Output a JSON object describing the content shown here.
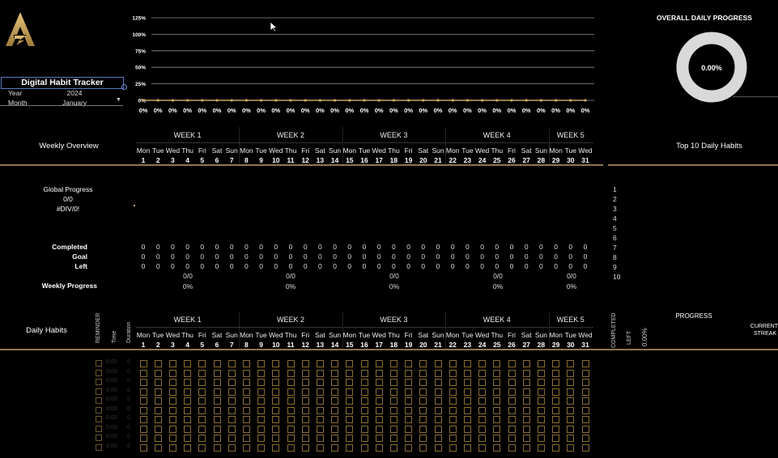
{
  "sidebar": {
    "title": "Digital Habit Tracker",
    "year_label": "Year",
    "year_value": "2024",
    "month_label": "Month",
    "month_value": "January"
  },
  "chart_data": {
    "type": "line",
    "y_ticks": [
      "125%",
      "100%",
      "75%",
      "50%",
      "25%",
      "0%"
    ],
    "ylim": [
      0,
      1.25
    ],
    "x": [
      1,
      2,
      3,
      4,
      5,
      6,
      7,
      8,
      9,
      10,
      11,
      12,
      13,
      14,
      15,
      16,
      17,
      18,
      19,
      20,
      21,
      22,
      23,
      24,
      25,
      26,
      27,
      28,
      29,
      30,
      31
    ],
    "values": [
      0,
      0,
      0,
      0,
      0,
      0,
      0,
      0,
      0,
      0,
      0,
      0,
      0,
      0,
      0,
      0,
      0,
      0,
      0,
      0,
      0,
      0,
      0,
      0,
      0,
      0,
      0,
      0,
      0,
      0,
      0
    ],
    "value_labels": [
      "0%",
      "0%",
      "0%",
      "0%",
      "0%",
      "0%",
      "0%",
      "0%",
      "0%",
      "0%",
      "0%",
      "0%",
      "0%",
      "0%",
      "0%",
      "0%",
      "0%",
      "0%",
      "0%",
      "0%",
      "0%",
      "0%",
      "0%",
      "0%",
      "0%",
      "0%",
      "0%",
      "0%",
      "0%",
      "0%",
      "0%"
    ],
    "line_color": "#c9a463",
    "grid": true
  },
  "overall": {
    "title": "OVERALL DAILY PROGRESS",
    "value": "0.00%",
    "ring_color": "#d9d9d9"
  },
  "weekly_overview": {
    "title": "Weekly Overview",
    "top_habits_title": "Top 10 Daily Habits",
    "global_progress_label": "Global Progress",
    "global_progress_count": "0/0",
    "global_progress_pct": "#DIV/0!",
    "rows": [
      "Completed",
      "Goal",
      "Left"
    ],
    "weekly_progress_label": "Weekly Progress",
    "week_summaries": [
      {
        "count": "0/0",
        "pct": "0%"
      },
      {
        "count": "0/0",
        "pct": "0%"
      },
      {
        "count": "0/0",
        "pct": "0%"
      },
      {
        "count": "0/0",
        "pct": "0%"
      },
      {
        "count": "0/0",
        "pct": "0%"
      }
    ],
    "ranks": [
      "1",
      "2",
      "3",
      "4",
      "5",
      "6",
      "7",
      "8",
      "9",
      "10"
    ]
  },
  "calendar": {
    "weeks": [
      "WEEK 1",
      "WEEK 2",
      "WEEK 3",
      "WEEK 4",
      "WEEK 5"
    ],
    "day_names": [
      "Mon",
      "Tue",
      "Wed",
      "Thu",
      "Fri",
      "Sat",
      "Sun",
      "Mon",
      "Tue",
      "Wed",
      "Thu",
      "Fri",
      "Sat",
      "Sun",
      "Mon",
      "Tue",
      "Wed",
      "Thu",
      "Fri",
      "Sat",
      "Sun",
      "Mon",
      "Tue",
      "Wed",
      "Thu",
      "Fri",
      "Sat",
      "Sun",
      "Mon",
      "Tue",
      "Wed"
    ],
    "day_numbers": [
      "1",
      "2",
      "3",
      "4",
      "5",
      "6",
      "7",
      "8",
      "9",
      "10",
      "11",
      "12",
      "13",
      "14",
      "15",
      "16",
      "17",
      "18",
      "19",
      "20",
      "21",
      "22",
      "23",
      "24",
      "25",
      "26",
      "27",
      "28",
      "29",
      "30",
      "31"
    ],
    "zero": "0"
  },
  "daily_habits": {
    "title": "Daily Habits",
    "col_reminder": "REMINDER",
    "col_time": "Time",
    "col_duration": "Duration",
    "col_completed": "COMPLETED",
    "col_left": "LEFT",
    "progress_pct": "0.00%",
    "progress_title": "PROGRESS",
    "streak_line1": "CURRENT",
    "streak_line2": "STREAK",
    "time_placeholder": "0:00",
    "duration_placeholder": "0",
    "row_count": 10
  },
  "colors": {
    "accent_gold": "#8f7649",
    "checkbox_border": "#8a6d30",
    "title_border": "#5a7bbf"
  }
}
